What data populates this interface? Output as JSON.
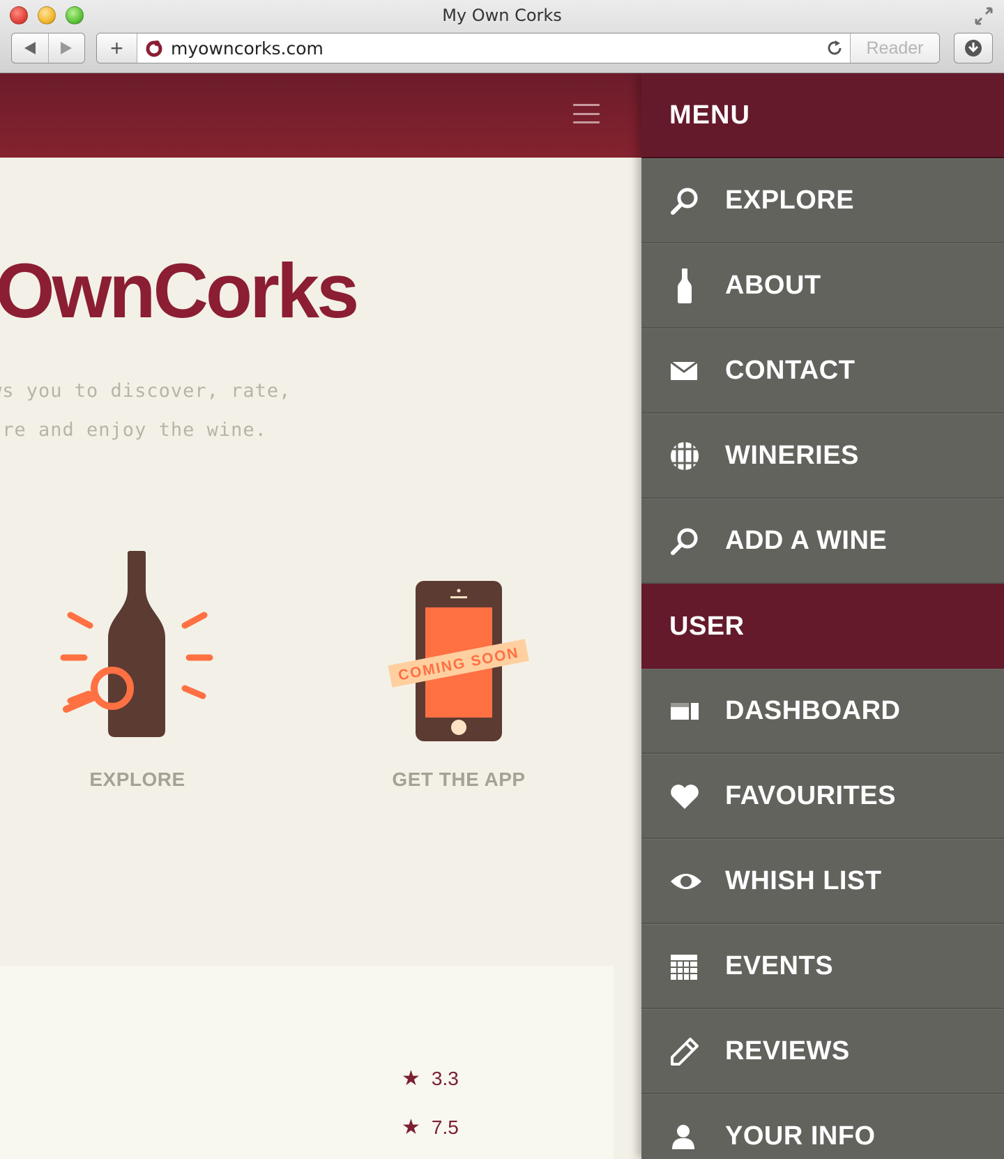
{
  "browser": {
    "window_title": "My Own Corks",
    "url": "myowncorks.com",
    "reader_label": "Reader"
  },
  "site": {
    "logo_text": "yOwnCorks",
    "tagline_line1": "ws you to discover, rate,",
    "tagline_line2": "are and enjoy the wine.",
    "features": [
      {
        "label": "EXPLORE",
        "icon": "wine-bottle-search-icon"
      },
      {
        "label": "GET THE APP",
        "icon": "phone-icon",
        "ribbon": "COMING SOON"
      }
    ],
    "ratings": [
      "3.3",
      "7.5"
    ],
    "colors": {
      "brand": "#7c1f31",
      "background": "#f3f1e7",
      "accent": "#ff7043",
      "bottle": "#5c3b33",
      "menu_bg": "#63635e"
    }
  },
  "menu": {
    "title": "MENU",
    "items": [
      {
        "label": "EXPLORE",
        "icon": "search-icon"
      },
      {
        "label": "ABOUT",
        "icon": "bottle-icon"
      },
      {
        "label": "CONTACT",
        "icon": "envelope-icon"
      },
      {
        "label": "WINERIES",
        "icon": "barrel-icon"
      },
      {
        "label": "ADD A WINE",
        "icon": "search-icon"
      }
    ],
    "user_title": "USER",
    "user_items": [
      {
        "label": "DASHBOARD",
        "icon": "dashboard-icon"
      },
      {
        "label": "FAVOURITES",
        "icon": "heart-icon"
      },
      {
        "label": "WHISH LIST",
        "icon": "eye-icon"
      },
      {
        "label": "EVENTS",
        "icon": "calendar-icon"
      },
      {
        "label": "REVIEWS",
        "icon": "pencil-icon"
      },
      {
        "label": "YOUR INFO",
        "icon": "user-icon"
      }
    ]
  }
}
